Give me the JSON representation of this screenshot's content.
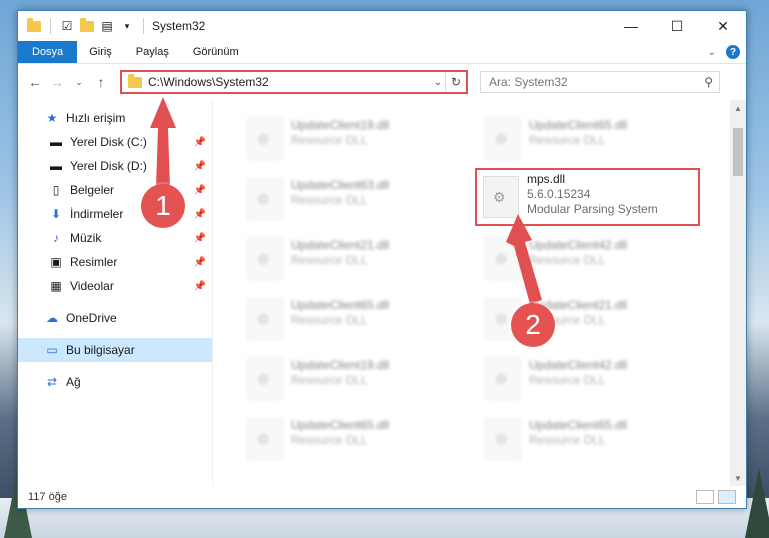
{
  "window": {
    "title": "System32",
    "controls": {
      "minimize": "—",
      "maximize": "☐",
      "close": "✕"
    }
  },
  "ribbon": {
    "tabs": [
      "Dosya",
      "Giriş",
      "Paylaş",
      "Görünüm"
    ],
    "help": "?"
  },
  "nav": {
    "address": "C:\\Windows\\System32",
    "search_placeholder": "Ara: System32"
  },
  "sidebar": {
    "quick_access": "Hızlı erişim",
    "items": [
      {
        "label": "Yerel Disk (C:)",
        "icon": "drive-icon"
      },
      {
        "label": "Yerel Disk (D:)",
        "icon": "drive-icon"
      },
      {
        "label": "Belgeler",
        "icon": "documents-icon"
      },
      {
        "label": "İndirmeler",
        "icon": "download-icon"
      },
      {
        "label": "Müzik",
        "icon": "music-icon"
      },
      {
        "label": "Resimler",
        "icon": "pictures-icon"
      },
      {
        "label": "Videolar",
        "icon": "videos-icon"
      }
    ],
    "onedrive": "OneDrive",
    "this_pc": "Bu bilgisayar",
    "network": "Ağ"
  },
  "files": {
    "left": [
      {
        "name": "UpdateClient19.dll",
        "type": "Resource DLL"
      },
      {
        "name": "UpdateClient63.dll",
        "type": "Resource DLL"
      },
      {
        "name": "UpdateClient21.dll",
        "type": "Resource DLL"
      },
      {
        "name": "UpdateClient65.dll",
        "type": "Resource DLL"
      },
      {
        "name": "UpdateClient19.dll",
        "type": "Resource DLL"
      },
      {
        "name": "UpdateClient65.dll",
        "type": "Resource DLL"
      }
    ],
    "right": [
      {
        "name": "UpdateClient65.dll",
        "type": "Resource DLL"
      },
      {
        "name": "mps.dll",
        "version": "5.6.0.15234",
        "type": "Modular Parsing System"
      },
      {
        "name": "UpdateClient42.dll",
        "type": "Resource DLL"
      },
      {
        "name": "UpdateClient21.dll",
        "type": "Resource DLL"
      },
      {
        "name": "UpdateClient42.dll",
        "type": "Resource DLL"
      },
      {
        "name": "UpdateClient65.dll",
        "type": "Resource DLL"
      }
    ]
  },
  "status": {
    "count": "117 öğe"
  },
  "annotations": {
    "step1": "1",
    "step2": "2",
    "color": "#e05050"
  }
}
